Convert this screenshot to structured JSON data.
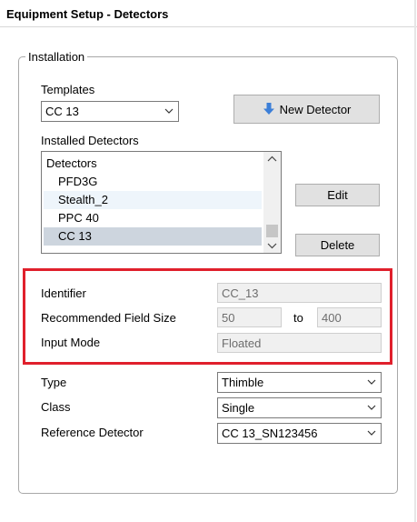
{
  "window": {
    "title": "Equipment Setup - Detectors"
  },
  "installation": {
    "group_label": "Installation",
    "templates": {
      "label": "Templates",
      "value": "CC 13"
    },
    "new_detector_button": {
      "label": "New Detector",
      "icon": "arrow-down-icon",
      "icon_color": "#3c7fd8"
    },
    "installed_detectors": {
      "label": "Installed Detectors",
      "header": "Detectors",
      "items": [
        {
          "label": "PFD3G",
          "selected": false
        },
        {
          "label": "Stealth_2",
          "selected": false
        },
        {
          "label": "PPC 40",
          "selected": false
        },
        {
          "label": "CC 13",
          "selected": true
        }
      ]
    },
    "edit_button": "Edit",
    "delete_button": "Delete"
  },
  "details": {
    "identifier": {
      "label": "Identifier",
      "value": "CC_13"
    },
    "field_size": {
      "label": "Recommended Field Size",
      "from": "50",
      "to_label": "to",
      "to": "400"
    },
    "input_mode": {
      "label": "Input Mode",
      "value": "Floated"
    },
    "highlight_color": "#e0202c"
  },
  "config": {
    "type": {
      "label": "Type",
      "value": "Thimble"
    },
    "class": {
      "label": "Class",
      "value": "Single"
    },
    "reference_detector": {
      "label": "Reference Detector",
      "value": "CC 13_SN123456"
    }
  }
}
